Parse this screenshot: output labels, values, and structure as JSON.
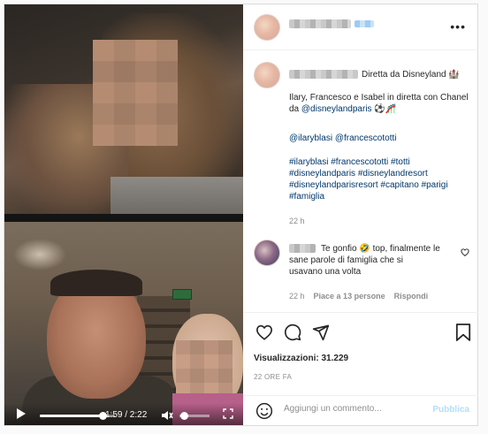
{
  "video": {
    "time": "1:59 / 2:22",
    "progress": 0.84,
    "volume": 0.15
  },
  "post": {
    "caption_title": "Diretta da Disneyland",
    "caption_body": "Ilary, Francesco e Isabel in diretta con Chanel da",
    "mention_disney": "@disneylandparis",
    "mention_ilary": "@ilaryblasi",
    "mention_totti": "@francescototti",
    "hashtags_line1": "#ilaryblasi #francescototti #totti",
    "hashtags_line2": "#disneylandparis #disneylandresort",
    "hashtags_line3": "#disneylandparisresort #capitano #parigi",
    "hashtags_line4": "#famiglia",
    "caption_time": "22 h"
  },
  "comment": {
    "text_line1": "Te gonfio 🤣 top, finalmente le",
    "text_line2": "sane parole di famiglia che si",
    "text_line3": "usavano una volta",
    "time": "22 h",
    "likes": "Piace a 13 persone",
    "reply": "Rispondi"
  },
  "stats": {
    "views": "Visualizzazioni: 31.229",
    "posted_ago": "22 ORE FA"
  },
  "composer": {
    "placeholder": "Aggiungi un commento...",
    "publish_label": "Pubblica"
  },
  "colors": {
    "link": "#00376b",
    "muted": "#8e8e8e",
    "publish_disabled": "#b2dffc"
  },
  "icons": [
    "more-options-icon",
    "heart-icon",
    "comment-icon",
    "share-icon",
    "bookmark-icon",
    "emoji-icon",
    "play-icon",
    "volume-icon",
    "fullscreen-icon",
    "comment-like-icon"
  ]
}
